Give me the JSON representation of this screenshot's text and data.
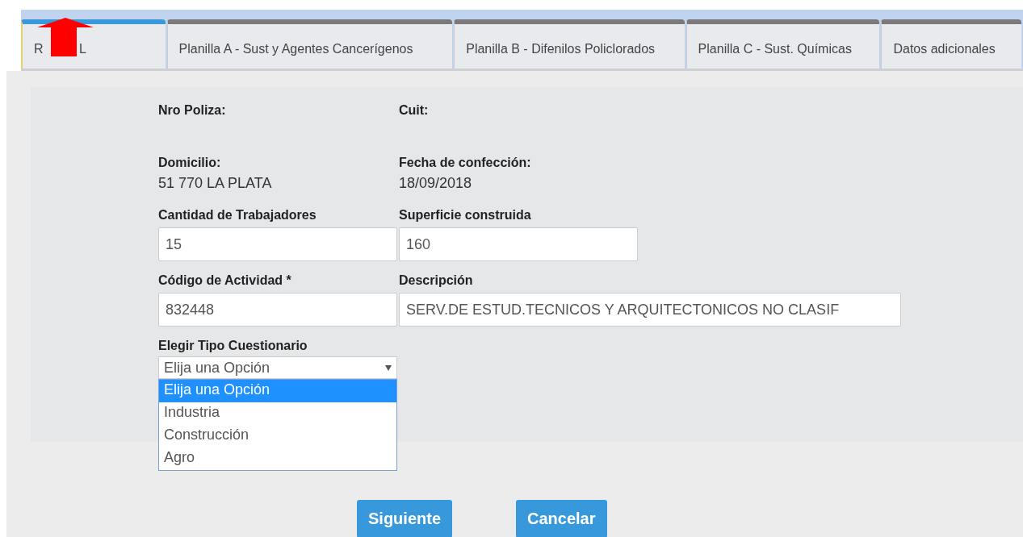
{
  "tabs": [
    {
      "label": "R L",
      "selected": true
    },
    {
      "label": "Planilla A - Sust  y Agentes Cancerígenos",
      "selected": false
    },
    {
      "label": "Planilla B - Difenilos Policlorados",
      "selected": false
    },
    {
      "label": "Planilla C - Sust. Químicas",
      "selected": false
    },
    {
      "label": "Datos adicionales",
      "selected": false
    }
  ],
  "info": [
    {
      "label": "Nro Poliza:"
    },
    {
      "label": "Cuit:"
    },
    {
      "label": "Domicilio:",
      "value": "51 770 LA PLATA"
    },
    {
      "label": "Fecha de confección:",
      "value": "18/09/2018"
    }
  ],
  "inputs": [
    {
      "label": "Cantidad de Trabajadores",
      "value": "15"
    },
    {
      "label": "Superficie construida",
      "value": "160"
    },
    {
      "label": "Código de Actividad *",
      "value": "832448"
    },
    {
      "label": "Descripción",
      "value": "SERV.DE ESTUD.TECNICOS Y ARQUITECTONICOS NO CLASIF"
    }
  ],
  "select": {
    "label": "Elegir Tipo Cuestionario",
    "value": "Elija una Opción",
    "expanded": true,
    "options": [
      {
        "label": "Elija una Opción",
        "selected": true
      },
      {
        "label": "Industria",
        "selected": false
      },
      {
        "label": "Construcción",
        "selected": false
      },
      {
        "label": "Agro",
        "selected": false
      }
    ]
  },
  "buttons": [
    "Siguiente",
    "Cancelar"
  ]
}
